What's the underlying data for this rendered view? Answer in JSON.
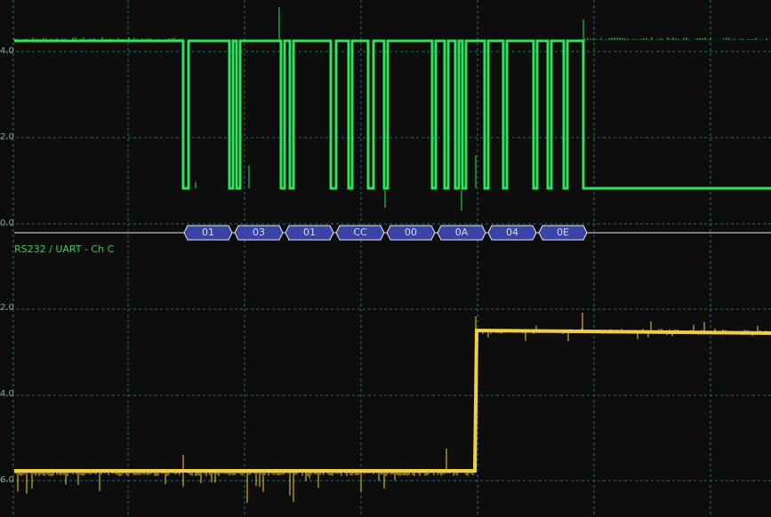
{
  "colors": {
    "background": "#0d0d0d",
    "grid": "#2e6a6a",
    "channel_a": "#2ee25a",
    "channel_b": "#f0d040",
    "decode_fill": "#3a44a8",
    "decode_text": "#d8dcff",
    "baseline": "#e8e8e8"
  },
  "y_axis_labels": {
    "a_4": "4.0",
    "a_2": "2.0",
    "a_0": "0.0",
    "b_2": "2.0",
    "b_4": "4.0",
    "b_6": "6.0"
  },
  "decoder": {
    "label": "RS232 / UART - Ch C",
    "bytes": [
      "01",
      "03",
      "01",
      "CC",
      "00",
      "0A",
      "04",
      "0E"
    ]
  }
}
